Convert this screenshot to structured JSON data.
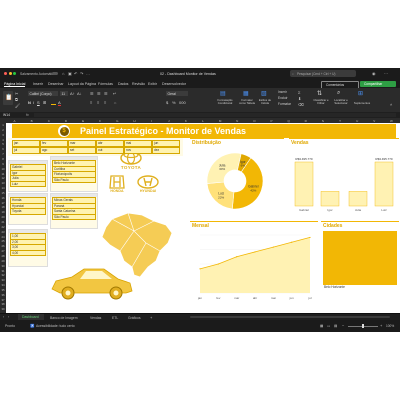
{
  "window": {
    "autosave": "Salvamento Automático",
    "title": "02 - Dashboard Monitor de Vendas",
    "search_placeholder": "Pesquisar (Cmd + Ctrl + U)"
  },
  "menu": [
    "Página Inicial",
    "Inserir",
    "Desenhar",
    "Layout da Página",
    "Fórmulas",
    "Dados",
    "Revisão",
    "Exibir",
    "Desenvolvedor"
  ],
  "menu_right": {
    "comments": "Comentários",
    "share": "Compartilhar"
  },
  "ribbon": {
    "font_name": "Calibri (Corpo)",
    "font_size": "11",
    "number_format": "Geral",
    "cond_format": "Formatação Condicional",
    "format_table": "Formatar como Tabela",
    "cell_styles": "Estilos de Célula",
    "insert": "Inserir",
    "delete": "Excluir",
    "format": "Formatar",
    "sort_filter": "Classificar e Filtrar",
    "find_select": "Localizar e Selecionar",
    "addins": "Suplementos"
  },
  "formula_bar": {
    "cell": "W14",
    "fx": "fx"
  },
  "columns": [
    "A",
    "B",
    "C",
    "D",
    "E",
    "F",
    "G",
    "H",
    "I",
    "J",
    "K",
    "L",
    "M",
    "N",
    "O",
    "P",
    "Q",
    "R",
    "S",
    "T",
    "U",
    "V",
    "W"
  ],
  "rows": [
    "1",
    "2",
    "3",
    "4",
    "5",
    "6",
    "7",
    "8",
    "9",
    "10",
    "11",
    "12",
    "13",
    "14",
    "15",
    "16",
    "17",
    "18",
    "19",
    "20",
    "21",
    "22",
    "23",
    "24",
    "25",
    "26",
    "27",
    "28",
    "29",
    "30",
    "31",
    "32",
    "33",
    "34",
    "35",
    "36",
    "37",
    "38",
    "39"
  ],
  "dashboard": {
    "title": "Painel Estratégico - Monitor de Vendas",
    "months_row1": [
      "jan",
      "fev",
      "mar",
      "abr",
      "mai",
      "jun"
    ],
    "months_row2": [
      "jul",
      "ago",
      "set",
      "out",
      "nov",
      "dez"
    ],
    "filter1": [
      "Gabriel",
      "Igor",
      "Julia",
      "Luiz"
    ],
    "filter2": [
      "Belo Horizonte",
      "Curitiba",
      "Florianópolis",
      "São Paulo"
    ],
    "filter3": [
      "Honda",
      "Hyundai",
      "Toyota"
    ],
    "filter4": [
      "Minas Gerais",
      "Paraná",
      "Santa Catarina",
      "São Paulo"
    ],
    "filter5": [
      "1,00",
      "2,00",
      "3,00",
      "4,00"
    ],
    "brands": [
      "TOYOTA",
      "HONDA",
      "HYUNDAI"
    ],
    "distribuicao_label": "Distribuição",
    "vendas_label": "Vendas",
    "mensal_label": "Mensal",
    "cidades_label": "Cidades",
    "cidades_bar": "Belo Horizonte",
    "mensal_months": [
      "jan",
      "fev",
      "mar",
      "abr",
      "mai",
      "jun",
      "jul"
    ],
    "vendas_labels": {
      "left": "Julia",
      "right": "Gabriel",
      "top": "Igor",
      "bottom": "Luiz"
    }
  },
  "chart_data": [
    {
      "type": "pie",
      "title": "Distribuição",
      "labels": [
        "Gabriel",
        "Luiz",
        "Julia",
        "Igor"
      ],
      "values": [
        42,
        22,
        30,
        6
      ],
      "colors": [
        "#f2b705",
        "#ffe17a",
        "#fff2b3",
        "#e0a800"
      ]
    },
    {
      "type": "bar",
      "title": "Vendas",
      "categories": [
        "Gabriel",
        "Igor",
        "Julia",
        "Luiz"
      ],
      "values": [
        3,
        1,
        1,
        3
      ],
      "data_labels": [
        "R$3.495.770",
        "",
        "",
        "R$3.495.770"
      ]
    },
    {
      "type": "area",
      "title": "Mensal",
      "categories": [
        "jan",
        "fev",
        "mar",
        "abr",
        "mai",
        "jun",
        "jul"
      ],
      "values": [
        5,
        6,
        7.5,
        8.5,
        9.5,
        10.5,
        11.5
      ],
      "ylim": [
        0,
        12
      ]
    }
  ],
  "sheet_tabs": [
    "Dashboard",
    "Banco de Imagem",
    "Vendas",
    "ETL",
    "Gráficos"
  ],
  "status": {
    "mode": "Pronto",
    "accessibility": "Acessibilidade: tudo certo",
    "zoom": "100%"
  }
}
